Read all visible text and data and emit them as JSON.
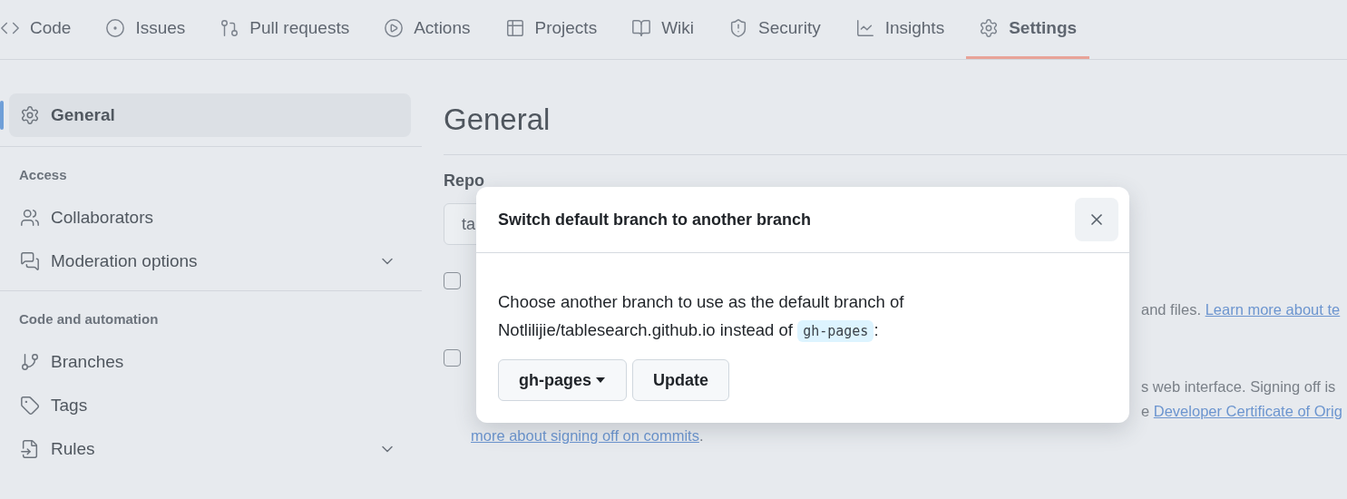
{
  "tabs": [
    {
      "label": "Code",
      "selected": false
    },
    {
      "label": "Issues",
      "selected": false
    },
    {
      "label": "Pull requests",
      "selected": false
    },
    {
      "label": "Actions",
      "selected": false
    },
    {
      "label": "Projects",
      "selected": false
    },
    {
      "label": "Wiki",
      "selected": false
    },
    {
      "label": "Security",
      "selected": false
    },
    {
      "label": "Insights",
      "selected": false
    },
    {
      "label": "Settings",
      "selected": true
    }
  ],
  "sidebar": {
    "sections": [
      {
        "items": [
          {
            "label": "General",
            "kind": "link",
            "selected": true
          }
        ]
      },
      {
        "heading": "Access",
        "items": [
          {
            "label": "Collaborators",
            "kind": "link",
            "selected": false
          },
          {
            "label": "Moderation options",
            "kind": "group",
            "selected": false
          }
        ]
      },
      {
        "heading": "Code and automation",
        "items": [
          {
            "label": "Branches",
            "kind": "link",
            "selected": false
          },
          {
            "label": "Tags",
            "kind": "link",
            "selected": false
          },
          {
            "label": "Rules",
            "kind": "group",
            "selected": false
          }
        ]
      }
    ]
  },
  "main": {
    "title": "General",
    "section_label": "Repo",
    "name_field": {
      "value": "ta"
    },
    "options": [
      {
        "checked": false,
        "lines": [
          {
            "right": "and files. ",
            "link": "Learn more about te"
          }
        ]
      },
      {
        "checked": false,
        "lines": [
          {
            "right": "s web interface. Signing off is"
          },
          {
            "right": "e ",
            "link": "Developer Certificate of Orig"
          },
          {
            "link": "more about signing off on commits",
            "after": "."
          }
        ]
      }
    ]
  },
  "dialog": {
    "title": "Switch default branch to another branch",
    "body_before": "Choose another branch to use as the default branch of Notlilijie/tablesearch.github.io instead of",
    "branch_code": "gh-pages",
    "body_after": ":",
    "branch_button": "gh-pages",
    "update_button": "Update"
  }
}
